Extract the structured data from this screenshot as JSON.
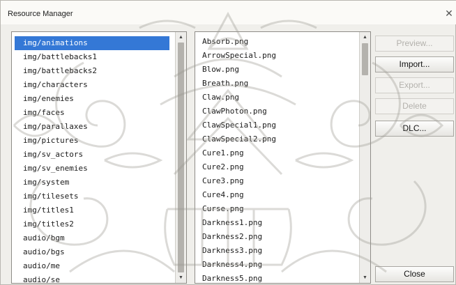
{
  "window": {
    "title": "Resource Manager",
    "close_glyph": "✕"
  },
  "folders": [
    "img/animations",
    "img/battlebacks1",
    "img/battlebacks2",
    "img/characters",
    "img/enemies",
    "img/faces",
    "img/parallaxes",
    "img/pictures",
    "img/sv_actors",
    "img/sv_enemies",
    "img/system",
    "img/tilesets",
    "img/titles1",
    "img/titles2",
    "audio/bgm",
    "audio/bgs",
    "audio/me",
    "audio/se"
  ],
  "selected_folder": "img/animations",
  "files": [
    "Absorb.png",
    "ArrowSpecial.png",
    "Blow.png",
    "Breath.png",
    "Claw.png",
    "ClawPhoton.png",
    "ClawSpecial1.png",
    "ClawSpecial2.png",
    "Cure1.png",
    "Cure2.png",
    "Cure3.png",
    "Cure4.png",
    "Curse.png",
    "Darkness1.png",
    "Darkness2.png",
    "Darkness3.png",
    "Darkness4.png",
    "Darkness5.png"
  ],
  "buttons": {
    "preview": "Preview...",
    "import": "Import...",
    "export": "Export...",
    "delete": "Delete",
    "dlc": "DLC...",
    "close": "Close"
  },
  "colors": {
    "selection": "#3478d6",
    "watermark": "#9a9890"
  }
}
